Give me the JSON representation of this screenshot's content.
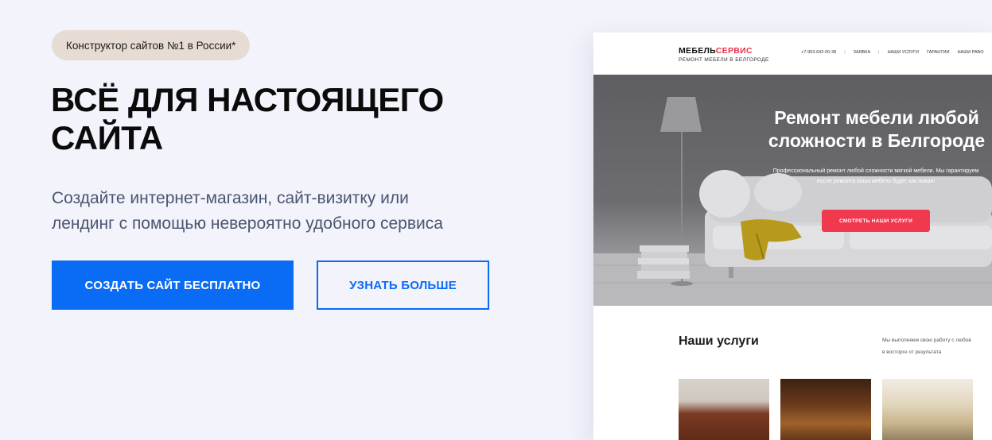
{
  "hero": {
    "badge": "Конструктор сайтов №1 в России*",
    "title_line1": "ВСЁ ДЛЯ НАСТОЯЩЕГО",
    "title_line2": "САЙТА",
    "subtitle_line1": "Создайте интернет-магазин, сайт-визитку или",
    "subtitle_line2": "лендинг с помощью невероятно удобного сервиса",
    "primary_button": "СОЗДАТЬ САЙТ БЕСПЛАТНО",
    "secondary_button": "УЗНАТЬ БОЛЬШЕ"
  },
  "preview": {
    "logo_main": "МЕБЕЛЬ",
    "logo_accent": "СЕРВИС",
    "logo_sub": "РЕМОНТ МЕБЕЛИ В БЕЛГОРОДЕ",
    "nav": {
      "phone": "+7-903-642-00-38",
      "sep": "|",
      "items": [
        "ЗАЯВКА",
        "НАШИ УСЛУГИ",
        "ГАРАНТИИ",
        "НАШИ РАБО"
      ]
    },
    "hero_title_line1": "Ремонт мебели любой",
    "hero_title_line2": "сложности в Белгороде",
    "hero_text_line1": "Профессиональный ремонт любой сложности мягкой мебели. Мы гарантируем",
    "hero_text_line2": "после ремонта ваша мебель будет как новая!",
    "hero_button": "СМОТРЕТЬ НАШИ УСЛУГИ",
    "services_title": "Наши услуги",
    "services_text_line1": "Мы выполняем свою работу с любов",
    "services_text_line2": "в восторге от результата"
  },
  "colors": {
    "background": "#f2f3fb",
    "primary_blue": "#0a6cf5",
    "badge_bg": "#e7dcd3",
    "preview_accent": "#e5334b",
    "preview_button": "#f0384f"
  }
}
